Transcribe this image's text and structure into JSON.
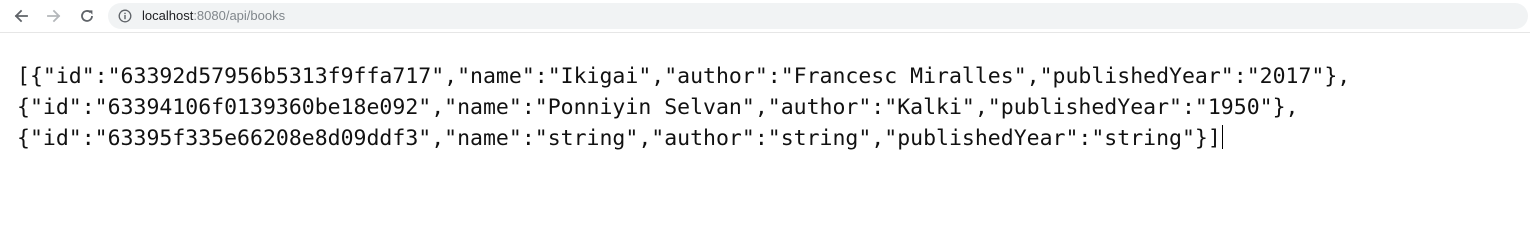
{
  "browser": {
    "back_icon": "arrow-left-icon",
    "forward_icon": "arrow-right-icon",
    "reload_icon": "reload-icon",
    "site_info_icon": "info-icon",
    "url_host": "localhost",
    "url_rest": ":8080/api/books"
  },
  "response": {
    "lines": [
      "[{\"id\":\"63392d57956b5313f9ffa717\",\"name\":\"Ikigai\",\"author\":\"Francesc Miralles\",\"publishedYear\":\"2017\"},",
      "{\"id\":\"63394106f0139360be18e092\",\"name\":\"Ponniyin Selvan\",\"author\":\"Kalki\",\"publishedYear\":\"1950\"},",
      "{\"id\":\"63395f335e66208e8d09ddf3\",\"name\":\"string\",\"author\":\"string\",\"publishedYear\":\"string\"}]"
    ]
  }
}
